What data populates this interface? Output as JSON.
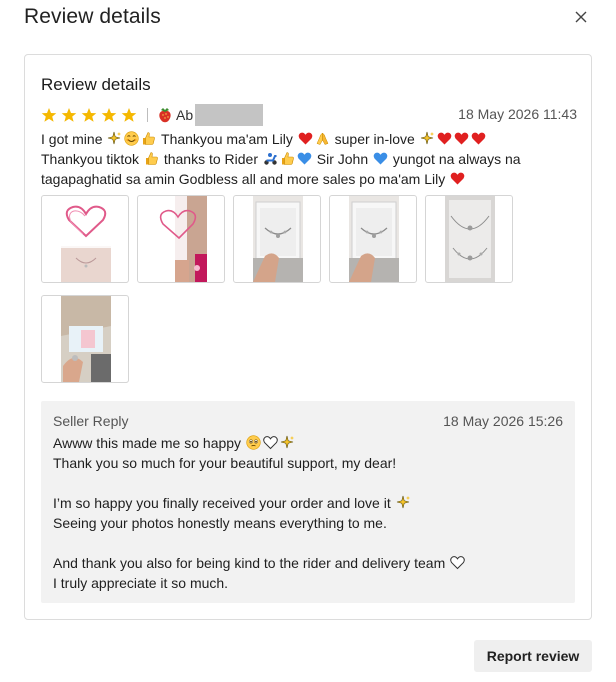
{
  "modal": {
    "title": "Review details",
    "close_icon": "close-icon"
  },
  "review": {
    "card_title": "Review details",
    "rating": 5,
    "max_rating": 5,
    "star_color": "#f5b800",
    "username": "Ab",
    "date": "18 May 2026 11:43",
    "lines": [
      {
        "segments": [
          {
            "t": "I got mine "
          },
          {
            "e": "sparkles"
          },
          {
            "e": "smile"
          },
          {
            "e": "thumbs"
          },
          {
            "t": " Thankyou ma'am Lily "
          },
          {
            "e": "heart-red"
          },
          {
            "e": "pray"
          },
          {
            "t": " super in-love "
          },
          {
            "e": "sparkles"
          },
          {
            "e": "heart-red"
          },
          {
            "e": "heart-red"
          },
          {
            "e": "heart-red"
          }
        ]
      },
      {
        "segments": [
          {
            "t": "Thankyou tiktok "
          },
          {
            "e": "thumbs"
          },
          {
            "t": " thanks to Rider "
          },
          {
            "e": "scooter"
          },
          {
            "e": "thumbs"
          },
          {
            "e": "heart-blue"
          },
          {
            "t": " Sir John "
          },
          {
            "e": "heart-blue"
          },
          {
            "t": " yungot na always na"
          }
        ]
      },
      {
        "segments": [
          {
            "t": "tagapaghatid sa amin Godbless all and more sales po ma'am Lily "
          },
          {
            "e": "heart-red"
          }
        ]
      }
    ],
    "photos": [
      {
        "kind": "heart-drawing"
      },
      {
        "kind": "heart-selfie"
      },
      {
        "kind": "jewelry-box"
      },
      {
        "kind": "jewelry-box"
      },
      {
        "kind": "necklace-flat"
      },
      {
        "kind": "parcel-open"
      }
    ]
  },
  "seller_reply": {
    "label": "Seller Reply",
    "date": "18 May 2026 15:26",
    "lines": [
      {
        "segments": [
          {
            "t": "Awww this made me so happy "
          },
          {
            "e": "pleading"
          },
          {
            "e": "heart-outline"
          },
          {
            "e": "sparkles"
          }
        ]
      },
      {
        "segments": [
          {
            "t": "Thank you so much for your beautiful support, my dear!"
          }
        ]
      },
      {
        "segments": []
      },
      {
        "segments": [
          {
            "t": "I’m so happy you finally received your order and love it "
          },
          {
            "e": "sparkles"
          }
        ]
      },
      {
        "segments": [
          {
            "t": "Seeing your photos honestly means everything to me."
          }
        ]
      },
      {
        "segments": []
      },
      {
        "segments": [
          {
            "t": "And thank you also for being kind to the rider and delivery team "
          },
          {
            "e": "heart-outline"
          }
        ]
      },
      {
        "segments": [
          {
            "t": "I truly appreciate it so much."
          }
        ]
      }
    ]
  },
  "footer": {
    "report_label": "Report review"
  }
}
